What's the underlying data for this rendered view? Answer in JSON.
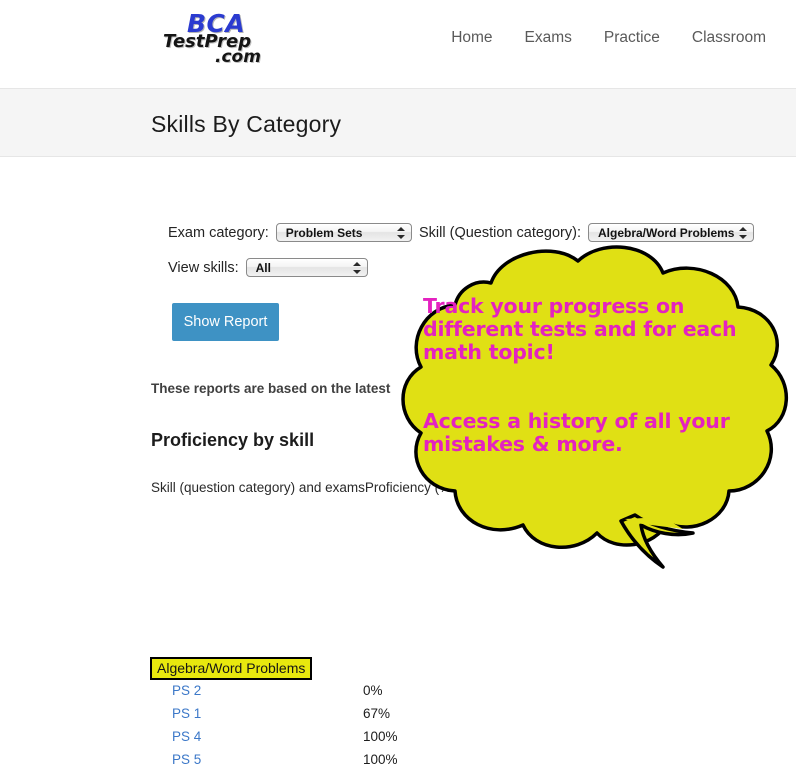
{
  "nav": {
    "logo": {
      "line1": "BCA",
      "line2": "TestPrep",
      "line3": ".com"
    },
    "links": [
      {
        "label": "Home"
      },
      {
        "label": "Exams"
      },
      {
        "label": "Practice"
      },
      {
        "label": "Classroom"
      }
    ]
  },
  "banner": {
    "title": "Skills By Category"
  },
  "controls": {
    "exam_category_label": "Exam category:",
    "exam_category_value": "Problem Sets",
    "skill_category_label": "Skill (Question category):",
    "skill_category_value": "Algebra/Word Problems",
    "view_skills_label": "View skills:",
    "view_skills_value": "All",
    "show_report_label": "Show Report"
  },
  "report": {
    "note": "These reports are based on the latest",
    "heading": "Proficiency by skill",
    "table_header": "Skill (question category) and examsProficiency (% correct answers)",
    "skill_group": "Algebra/Word Problems",
    "rows": [
      {
        "exam": "PS 2",
        "proficiency": "0%"
      },
      {
        "exam": "PS 1",
        "proficiency": "67%"
      },
      {
        "exam": "PS 4",
        "proficiency": "100%"
      },
      {
        "exam": "PS 5",
        "proficiency": "100%"
      }
    ]
  },
  "callout": {
    "line1": "Track your progress on different tests and for each math topic!",
    "line2": "Access a history of all your mistakes & more.",
    "fill_color": "#e0e014",
    "text_color": "#e422c0",
    "outline_color": "#000000"
  }
}
